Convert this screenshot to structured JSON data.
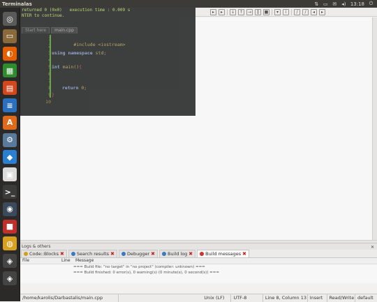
{
  "panel": {
    "title": "Terminalas",
    "clock": "13:18"
  },
  "launcher": {
    "items": [
      {
        "name": "dash-home-icon",
        "color": "#5a5a5a",
        "glyph": "◎"
      },
      {
        "name": "files-icon",
        "color": "#8a6a3a",
        "glyph": "▭"
      },
      {
        "name": "firefox-icon",
        "color": "#e66000",
        "glyph": "◐"
      },
      {
        "name": "calc-icon",
        "color": "#2e8b2e",
        "glyph": "▦"
      },
      {
        "name": "impress-icon",
        "color": "#d1481e",
        "glyph": "▤"
      },
      {
        "name": "writer-icon",
        "color": "#2a6fc0",
        "glyph": "≡"
      },
      {
        "name": "software-center-icon",
        "color": "#e06a1c",
        "glyph": "A"
      },
      {
        "name": "settings-icon",
        "color": "#5a7a9a",
        "glyph": "⚙"
      },
      {
        "name": "amazon-icon",
        "color": "#2a7fd0",
        "glyph": "◆"
      },
      {
        "name": "codeblocks-icon",
        "color": "#dcdcdc",
        "glyph": "▣"
      },
      {
        "name": "terminal-icon",
        "color": "#3b3b3b",
        "glyph": ">_"
      },
      {
        "name": "steam-icon",
        "color": "#3a4a5a",
        "glyph": "◉"
      },
      {
        "name": "color-app-icon",
        "color": "#c0302a",
        "glyph": "■"
      },
      {
        "name": "chrome-icon",
        "color": "#d8a020",
        "glyph": "◍"
      },
      {
        "name": "unity-icon",
        "color": "#444",
        "glyph": "◈"
      },
      {
        "name": "unity2-icon",
        "color": "#444",
        "glyph": "◈"
      }
    ]
  },
  "terminal": {
    "line1": "returned 0 (0x0)   execution time : 0.009 s",
    "line2": "NTER to continue."
  },
  "editor": {
    "tab_start": "Start here",
    "tab_file": "main.cpp",
    "line_numbers": [
      "1",
      "2",
      "3",
      "4",
      "5",
      "6",
      "7",
      "8",
      "9",
      "10"
    ],
    "lines": {
      "l1": "#include <iostream>",
      "l3_kw": "using namespace",
      "l3_rest": " std;",
      "l5_kw": "int",
      "l5_rest": " main()",
      "l5_brace": "{",
      "l8_kw": "return",
      "l8_rest": " 0;",
      "l9": "}"
    }
  },
  "logs": {
    "title": "Logs & others",
    "tabs": [
      {
        "label": "Code::Blocks",
        "icon_color": "#d0a020"
      },
      {
        "label": "Search results",
        "icon_color": "#3a7ac0"
      },
      {
        "label": "Debugger",
        "icon_color": "#3a7ac0"
      },
      {
        "label": "Build log",
        "icon_color": "#3a7ac0"
      },
      {
        "label": "Build messages",
        "icon_color": "#d03030"
      }
    ],
    "columns": {
      "file": "File",
      "line": "Line",
      "message": "Message"
    },
    "rows": [
      {
        "file": "",
        "line": "",
        "message": "=== Build file: \"no target\" in \"no project\" (compiler: unknown) ==="
      },
      {
        "file": "",
        "line": "",
        "message": "=== Build finished: 0 error(s), 0 warning(s) (0 minute(s), 0 second(s)) ==="
      }
    ]
  },
  "status": {
    "path": "/home/karolis/Darbastalis/main.cpp",
    "eol": "Unix (LF)",
    "encoding": "UTF-8",
    "position": "Line 8, Column 13",
    "mode": "Insert",
    "access": "Read/Write",
    "theme": "default"
  }
}
